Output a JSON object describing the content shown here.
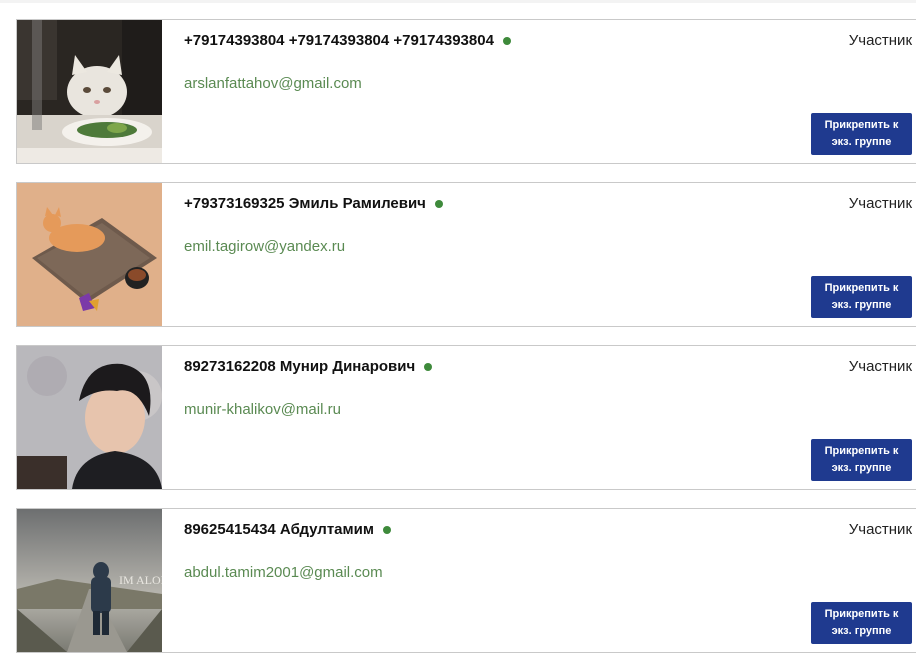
{
  "members": [
    {
      "name": "+79174393804 +79174393804 +79174393804",
      "email": "arslanfattahov@gmail.com",
      "role": "Участник",
      "button_label": "Прикрепить к экз. группе",
      "avatar": "cat-at-table-photo"
    },
    {
      "name": "+79373169325 Эмиль Рамилевич",
      "email": "emil.tagirow@yandex.ru",
      "role": "Участник",
      "button_label": "Прикрепить к экз. группе",
      "avatar": "cat-on-mat-photo"
    },
    {
      "name": "89273162208 Мунир Динарович",
      "email": "munir-khalikov@mail.ru",
      "role": "Участник",
      "button_label": "Прикрепить к экз. группе",
      "avatar": "young-man-portrait-photo"
    },
    {
      "name": "89625415434 Абдултамим",
      "email": "abdul.tamim2001@gmail.com",
      "role": "Участник",
      "button_label": "Прикрепить к экз. группе",
      "avatar": "im-alone-road-photo",
      "avatar_text": "IM ALONE"
    }
  ],
  "colors": {
    "status_online": "#3e8a3b",
    "email": "#5a8a52",
    "button": "#1f3a8f"
  }
}
